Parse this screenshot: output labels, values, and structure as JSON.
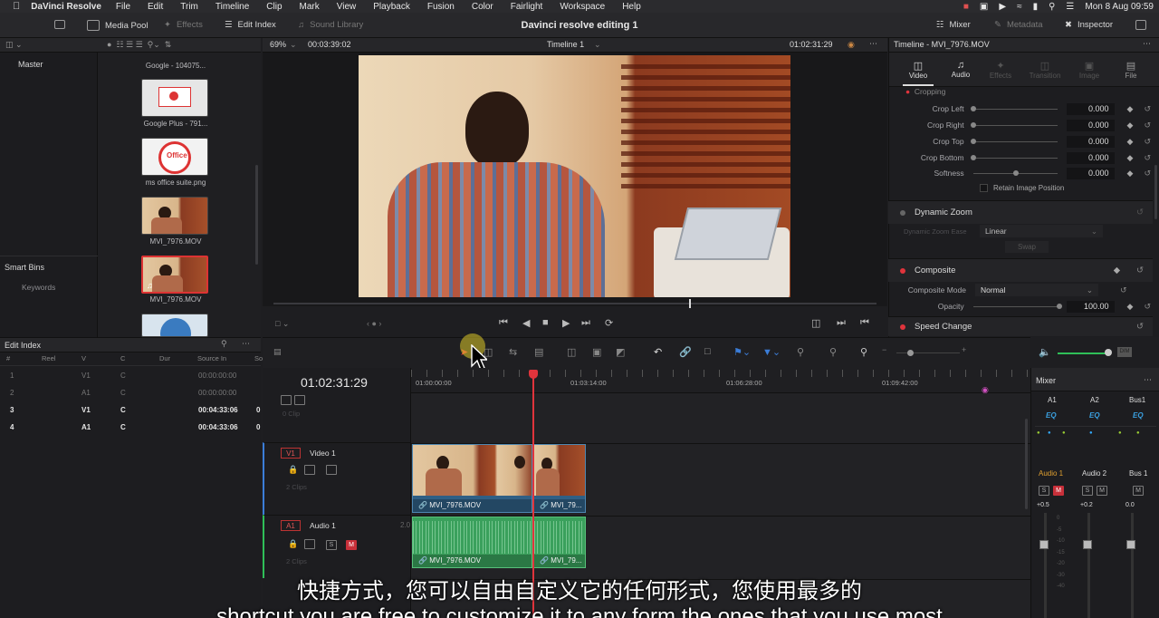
{
  "menubar": {
    "app": "DaVinci Resolve",
    "items": [
      "File",
      "Edit",
      "Trim",
      "Timeline",
      "Clip",
      "Mark",
      "View",
      "Playback",
      "Fusion",
      "Color",
      "Fairlight",
      "Workspace",
      "Help"
    ],
    "datetime": "Mon 8 Aug  09:59"
  },
  "toolbar": {
    "media_pool": "Media Pool",
    "effects": "Effects",
    "edit_index": "Edit Index",
    "sound_library": "Sound Library",
    "project_title": "Davinci resolve editing 1",
    "mixer": "Mixer",
    "metadata": "Metadata",
    "inspector": "Inspector"
  },
  "media_pool": {
    "bin": "Master",
    "smart_bins": "Smart Bins",
    "keywords": "Keywords",
    "clips": [
      {
        "label": "Google - 104075..."
      },
      {
        "label": "Google Plus - 791..."
      },
      {
        "label": "ms office suite.png"
      },
      {
        "label": "MVI_7976.MOV"
      },
      {
        "label": "MVI_7976.MOV"
      }
    ]
  },
  "viewer": {
    "zoom": "69%",
    "timecode_left": "00:03:39:02",
    "timeline_name": "Timeline 1",
    "timecode_right": "01:02:31:29"
  },
  "inspector": {
    "title": "Timeline - MVI_7976.MOV",
    "tabs": [
      "Video",
      "Audio",
      "Effects",
      "Transition",
      "Image",
      "File"
    ],
    "cropping": "Cropping",
    "crop_rows": [
      {
        "label": "Crop Left",
        "value": "0.000"
      },
      {
        "label": "Crop Right",
        "value": "0.000"
      },
      {
        "label": "Crop Top",
        "value": "0.000"
      },
      {
        "label": "Crop Bottom",
        "value": "0.000"
      },
      {
        "label": "Softness",
        "value": "0.000"
      }
    ],
    "retain": "Retain Image Position",
    "dynamic_zoom": "Dynamic Zoom",
    "dz_ease_label": "Dynamic Zoom Ease",
    "dz_ease_value": "Linear",
    "swap": "Swap",
    "composite": "Composite",
    "composite_mode_label": "Composite Mode",
    "composite_mode_value": "Normal",
    "opacity_label": "Opacity",
    "opacity_value": "100.00",
    "speed_change": "Speed Change"
  },
  "edit_index": {
    "title": "Edit Index",
    "columns": [
      "#",
      "Reel",
      "V",
      "C",
      "Dur",
      "Source In",
      "So"
    ],
    "rows": [
      {
        "num": "1",
        "v": "V1",
        "c": "C",
        "src_in": "00:00:00:00"
      },
      {
        "num": "2",
        "v": "A1",
        "c": "C",
        "src_in": "00:00:00:00"
      },
      {
        "num": "3",
        "v": "V1",
        "c": "C",
        "src_in": "00:04:33:06",
        "extra": "0"
      },
      {
        "num": "4",
        "v": "A1",
        "c": "C",
        "src_in": "00:04:33:06",
        "extra": "0"
      }
    ]
  },
  "timeline": {
    "timecode": "01:02:31:29",
    "ruler": [
      "01:00:00:00",
      "01:03:14:00",
      "01:06:28:00",
      "01:09:42:00"
    ],
    "empty_track_hint": "0 Clip",
    "video_track": {
      "id": "V1",
      "name": "Video 1",
      "clips_hint": "2 Clips"
    },
    "audio_track": {
      "id": "A1",
      "name": "Audio 1",
      "channels": "2.0",
      "clips_hint": "2 Clips"
    },
    "video_clips": [
      "MVI_7976.MOV",
      "MVI_79..."
    ],
    "audio_clips": [
      "MVI_7976.MOV",
      "MVI_79..."
    ],
    "s_label": "S",
    "m_label": "M"
  },
  "mixer": {
    "title": "Mixer",
    "channels": [
      "A1",
      "A2",
      "Bus1"
    ],
    "eq": "EQ",
    "strips": [
      "Audio 1",
      "Audio 2",
      "Bus 1"
    ],
    "levels": [
      "+0.5",
      "+0.2",
      "0.0"
    ],
    "scale": [
      "0",
      "-5",
      "-10",
      "-15",
      "-20",
      "-30",
      "-40"
    ]
  },
  "subtitles": {
    "zh": "快捷方式，您可以自由自定义它的任何形式，您使用最多的",
    "en": "shortcut you are free to customize it to any form the ones that you use most"
  },
  "colors": {
    "accent_red": "#e0343c",
    "video_clip": "#2f5f85",
    "audio_clip": "#3aa05c"
  }
}
